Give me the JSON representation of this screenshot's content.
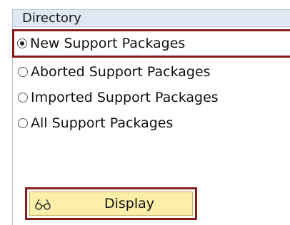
{
  "directory": {
    "title": "Directory",
    "options": [
      {
        "label": "New Support Packages",
        "selected": true
      },
      {
        "label": "Aborted Support Packages",
        "selected": false
      },
      {
        "label": "Imported Support Packages",
        "selected": false
      },
      {
        "label": "All Support Packages",
        "selected": false
      }
    ],
    "display_button_label": "Display",
    "display_button_icon": "glasses-icon"
  },
  "colors": {
    "header_bg": "#dfe8f2",
    "highlight_border": "#8a1b1b",
    "button_bg": "#fcefa9"
  }
}
